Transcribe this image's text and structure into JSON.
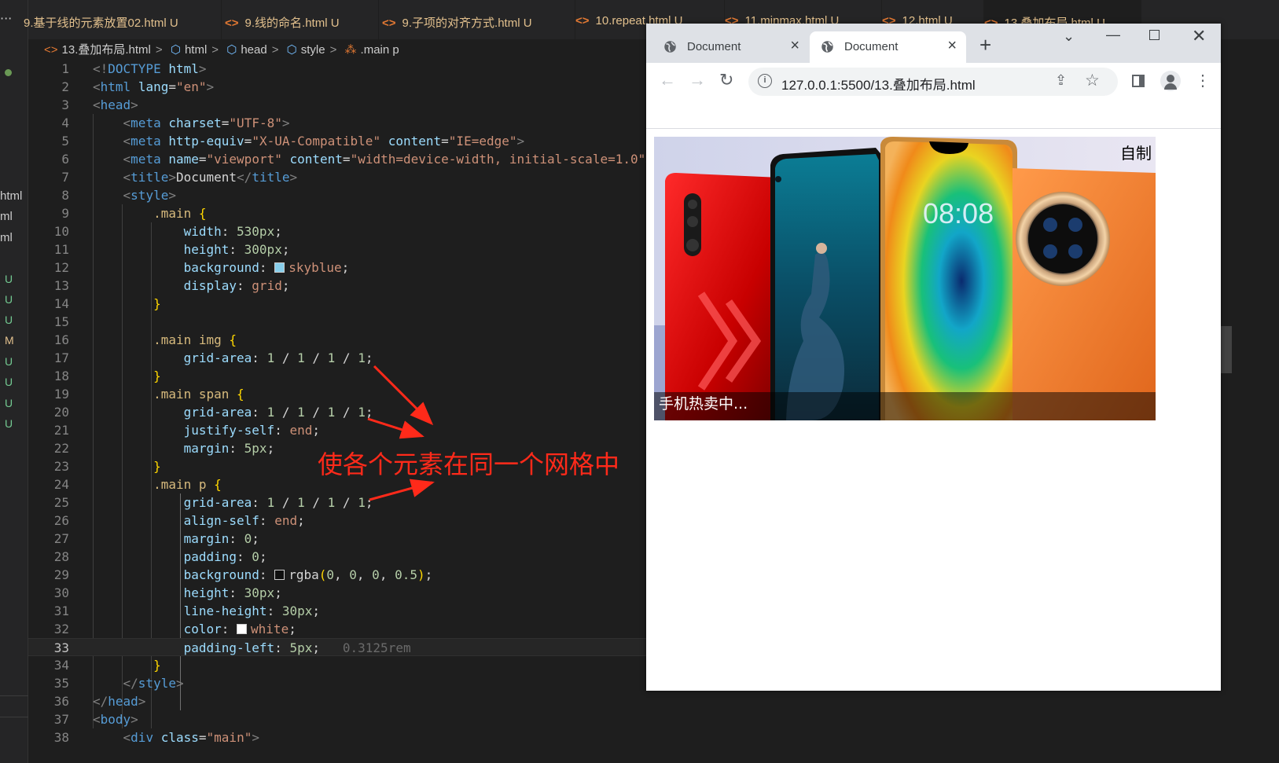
{
  "editor": {
    "tabs": [
      {
        "label": "9.基于线的元素放置02.html",
        "status": "U"
      },
      {
        "label": "9.线的命名.html",
        "status": "U"
      },
      {
        "label": "9.子项的对齐方式.html",
        "status": "U"
      },
      {
        "label": "10.repeat.html",
        "status": "U"
      },
      {
        "label": "11.minmax.html",
        "status": "U"
      },
      {
        "label": "12.html",
        "status": "U"
      },
      {
        "label": "13.叠加布局.html",
        "status": "U"
      }
    ],
    "breadcrumb": [
      "13.叠加布局.html",
      "html",
      "head",
      "style",
      ".main p"
    ],
    "sidebar_fragments": [
      "html",
      "ml",
      "ml"
    ],
    "sidebar_status": [
      "U",
      "U",
      "U",
      "M",
      "U",
      "U",
      "U",
      "U"
    ],
    "current_line": 33,
    "inline_hint": "0.3125rem",
    "annotation": "使各个元素在同一个网格中"
  },
  "browser": {
    "tabs": [
      {
        "title": "Document",
        "active": false
      },
      {
        "title": "Document",
        "active": true
      }
    ],
    "url": "127.0.0.1:5500/13.叠加布局.html",
    "page": {
      "corner_label": "自制",
      "caption": "手机热卖中..."
    }
  }
}
